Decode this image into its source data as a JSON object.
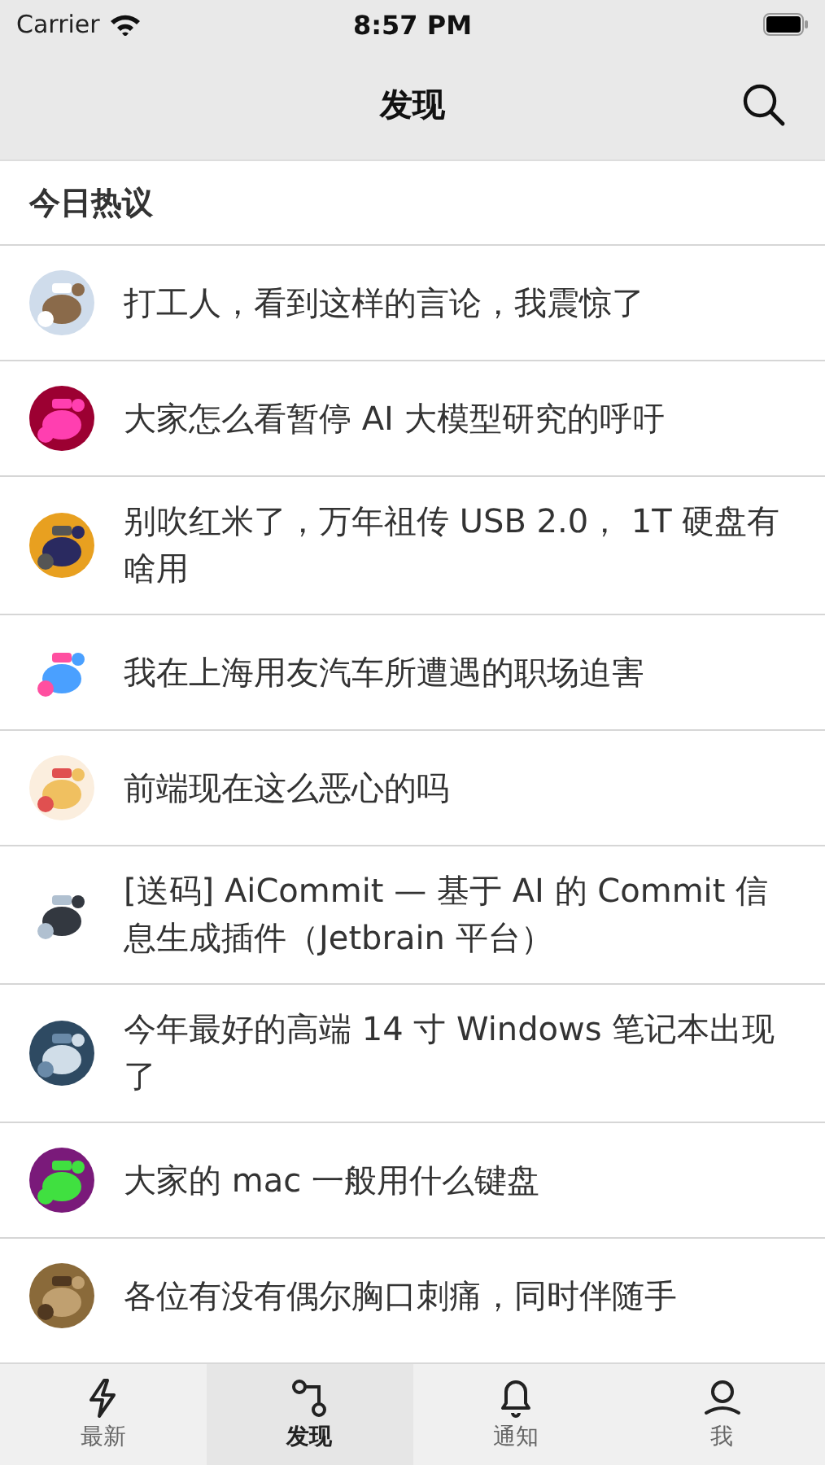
{
  "status_bar": {
    "carrier": "Carrier",
    "time": "8:57 PM"
  },
  "nav": {
    "title": "发现"
  },
  "section": {
    "title": "今日热议"
  },
  "topics": [
    {
      "title": "打工人，看到这样的言论，我震惊了"
    },
    {
      "title": "大家怎么看暂停 AI 大模型研究的呼吁"
    },
    {
      "title": "别吹红米了，万年祖传 USB 2.0， 1T 硬盘有啥用"
    },
    {
      "title": "我在上海用友汽车所遭遇的职场迫害"
    },
    {
      "title": "前端现在这么恶心的吗"
    },
    {
      "title": "[送码] AiCommit — 基于 AI 的 Commit 信息生成插件（Jetbrain 平台）"
    },
    {
      "title": "今年最好的高端 14 寸 Windows 笔记本出现了"
    },
    {
      "title": "大家的 mac 一般用什么键盘"
    },
    {
      "title": "各位有没有偶尔胸口刺痛，同时伴随手"
    }
  ],
  "tabs": [
    {
      "label": "最新",
      "kind": "bolt",
      "selected": false
    },
    {
      "label": "发现",
      "kind": "nodes",
      "selected": true
    },
    {
      "label": "通知",
      "kind": "bell",
      "selected": false
    },
    {
      "label": "我",
      "kind": "person",
      "selected": false
    }
  ]
}
